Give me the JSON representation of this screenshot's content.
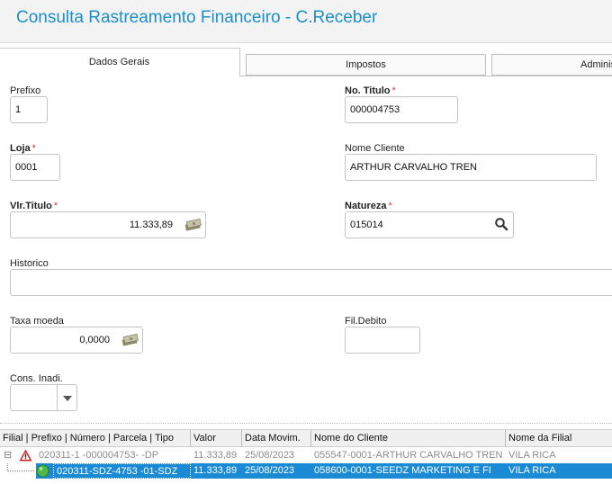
{
  "window": {
    "title": "Consulta Rastreamento Financeiro - C.Receber"
  },
  "tabs": [
    {
      "label": "Dados Gerais"
    },
    {
      "label": "Impostos"
    },
    {
      "label": "Adminis"
    }
  ],
  "form": {
    "prefixo": {
      "label": "Prefixo",
      "value": "1"
    },
    "no_titulo": {
      "label": "No. Titulo",
      "required": "*",
      "value": "000004753"
    },
    "loja": {
      "label": "Loja",
      "required": "*",
      "value": "0001"
    },
    "nome_cliente": {
      "label": "Nome Cliente",
      "value": "ARTHUR CARVALHO TREN"
    },
    "vlr_titulo": {
      "label": "Vlr.Titulo",
      "required": "*",
      "value": "11.333,89"
    },
    "natureza": {
      "label": "Natureza",
      "required": "*",
      "value": "015014"
    },
    "historico": {
      "label": "Historico",
      "value": ""
    },
    "taxa_moeda": {
      "label": "Taxa moeda",
      "value": "0,0000"
    },
    "fil_debito": {
      "label": "Fil.Debito",
      "value": ""
    },
    "cons_inadi": {
      "label": "Cons. Inadi.",
      "value": ""
    }
  },
  "grid": {
    "headers": [
      "Filial | Prefixo | Número | Parcela | Tipo",
      "Valor",
      "Data Movim.",
      "Nome do Cliente",
      "Nome da Filial"
    ],
    "rows": [
      {
        "tree": "⊟",
        "icon": "warning-icon",
        "filial": "020311-1  -000004753-  -DP",
        "valor": "11.333,89",
        "data": "25/08/2023",
        "cliente": "055547-0001-ARTHUR CARVALHO TREN",
        "nome_filial": "VILA RICA"
      },
      {
        "tree": "",
        "icon": "status-green-icon",
        "filial": "020311-SDZ-4753     -01-SDZ",
        "valor": "11.333,89",
        "data": "25/08/2023",
        "cliente": "058600-0001-SEEDZ MARKETING E FI",
        "nome_filial": "VILA RICA"
      }
    ]
  },
  "colors": {
    "title": "#1c8fc6",
    "selected_row": "#1a8ad4",
    "required": "#d83a3a"
  }
}
